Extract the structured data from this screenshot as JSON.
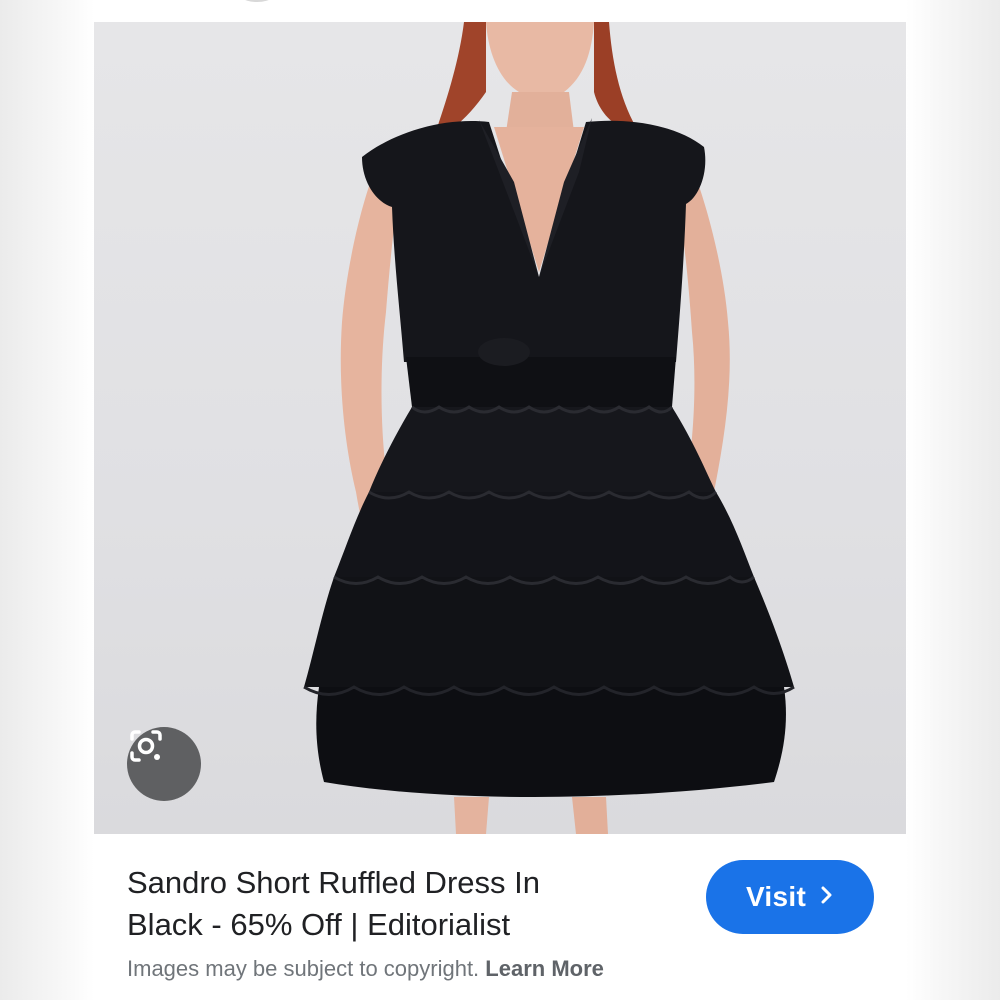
{
  "result_card": {
    "title_line1": "Sandro Short Ruffled Dress In",
    "title_line2": "Black - 65% Off | Editorialist",
    "visit_button": {
      "label": "Visit",
      "icon": "chevron-right-icon",
      "color": "#1a73e8"
    },
    "disclaimer": {
      "text": "Images may be subject to copyright.",
      "link": "Learn More"
    }
  },
  "image_overlay": {
    "lens_button_icon": "google-lens-icon"
  }
}
